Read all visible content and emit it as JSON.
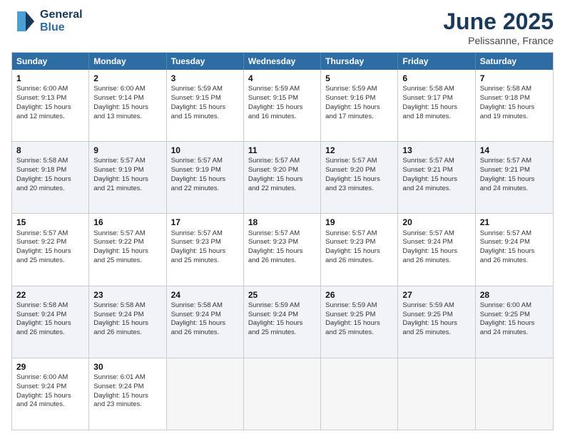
{
  "logo": {
    "line1": "General",
    "line2": "Blue"
  },
  "title": "June 2025",
  "subtitle": "Pelissanne, France",
  "header_days": [
    "Sunday",
    "Monday",
    "Tuesday",
    "Wednesday",
    "Thursday",
    "Friday",
    "Saturday"
  ],
  "rows": [
    [
      {
        "day": "1",
        "lines": [
          "Sunrise: 6:00 AM",
          "Sunset: 9:13 PM",
          "Daylight: 15 hours",
          "and 12 minutes."
        ]
      },
      {
        "day": "2",
        "lines": [
          "Sunrise: 6:00 AM",
          "Sunset: 9:14 PM",
          "Daylight: 15 hours",
          "and 13 minutes."
        ]
      },
      {
        "day": "3",
        "lines": [
          "Sunrise: 5:59 AM",
          "Sunset: 9:15 PM",
          "Daylight: 15 hours",
          "and 15 minutes."
        ]
      },
      {
        "day": "4",
        "lines": [
          "Sunrise: 5:59 AM",
          "Sunset: 9:15 PM",
          "Daylight: 15 hours",
          "and 16 minutes."
        ]
      },
      {
        "day": "5",
        "lines": [
          "Sunrise: 5:59 AM",
          "Sunset: 9:16 PM",
          "Daylight: 15 hours",
          "and 17 minutes."
        ]
      },
      {
        "day": "6",
        "lines": [
          "Sunrise: 5:58 AM",
          "Sunset: 9:17 PM",
          "Daylight: 15 hours",
          "and 18 minutes."
        ]
      },
      {
        "day": "7",
        "lines": [
          "Sunrise: 5:58 AM",
          "Sunset: 9:18 PM",
          "Daylight: 15 hours",
          "and 19 minutes."
        ]
      }
    ],
    [
      {
        "day": "8",
        "lines": [
          "Sunrise: 5:58 AM",
          "Sunset: 9:18 PM",
          "Daylight: 15 hours",
          "and 20 minutes."
        ]
      },
      {
        "day": "9",
        "lines": [
          "Sunrise: 5:57 AM",
          "Sunset: 9:19 PM",
          "Daylight: 15 hours",
          "and 21 minutes."
        ]
      },
      {
        "day": "10",
        "lines": [
          "Sunrise: 5:57 AM",
          "Sunset: 9:19 PM",
          "Daylight: 15 hours",
          "and 22 minutes."
        ]
      },
      {
        "day": "11",
        "lines": [
          "Sunrise: 5:57 AM",
          "Sunset: 9:20 PM",
          "Daylight: 15 hours",
          "and 22 minutes."
        ]
      },
      {
        "day": "12",
        "lines": [
          "Sunrise: 5:57 AM",
          "Sunset: 9:20 PM",
          "Daylight: 15 hours",
          "and 23 minutes."
        ]
      },
      {
        "day": "13",
        "lines": [
          "Sunrise: 5:57 AM",
          "Sunset: 9:21 PM",
          "Daylight: 15 hours",
          "and 24 minutes."
        ]
      },
      {
        "day": "14",
        "lines": [
          "Sunrise: 5:57 AM",
          "Sunset: 9:21 PM",
          "Daylight: 15 hours",
          "and 24 minutes."
        ]
      }
    ],
    [
      {
        "day": "15",
        "lines": [
          "Sunrise: 5:57 AM",
          "Sunset: 9:22 PM",
          "Daylight: 15 hours",
          "and 25 minutes."
        ]
      },
      {
        "day": "16",
        "lines": [
          "Sunrise: 5:57 AM",
          "Sunset: 9:22 PM",
          "Daylight: 15 hours",
          "and 25 minutes."
        ]
      },
      {
        "day": "17",
        "lines": [
          "Sunrise: 5:57 AM",
          "Sunset: 9:23 PM",
          "Daylight: 15 hours",
          "and 25 minutes."
        ]
      },
      {
        "day": "18",
        "lines": [
          "Sunrise: 5:57 AM",
          "Sunset: 9:23 PM",
          "Daylight: 15 hours",
          "and 26 minutes."
        ]
      },
      {
        "day": "19",
        "lines": [
          "Sunrise: 5:57 AM",
          "Sunset: 9:23 PM",
          "Daylight: 15 hours",
          "and 26 minutes."
        ]
      },
      {
        "day": "20",
        "lines": [
          "Sunrise: 5:57 AM",
          "Sunset: 9:24 PM",
          "Daylight: 15 hours",
          "and 26 minutes."
        ]
      },
      {
        "day": "21",
        "lines": [
          "Sunrise: 5:57 AM",
          "Sunset: 9:24 PM",
          "Daylight: 15 hours",
          "and 26 minutes."
        ]
      }
    ],
    [
      {
        "day": "22",
        "lines": [
          "Sunrise: 5:58 AM",
          "Sunset: 9:24 PM",
          "Daylight: 15 hours",
          "and 26 minutes."
        ]
      },
      {
        "day": "23",
        "lines": [
          "Sunrise: 5:58 AM",
          "Sunset: 9:24 PM",
          "Daylight: 15 hours",
          "and 26 minutes."
        ]
      },
      {
        "day": "24",
        "lines": [
          "Sunrise: 5:58 AM",
          "Sunset: 9:24 PM",
          "Daylight: 15 hours",
          "and 26 minutes."
        ]
      },
      {
        "day": "25",
        "lines": [
          "Sunrise: 5:59 AM",
          "Sunset: 9:24 PM",
          "Daylight: 15 hours",
          "and 25 minutes."
        ]
      },
      {
        "day": "26",
        "lines": [
          "Sunrise: 5:59 AM",
          "Sunset: 9:25 PM",
          "Daylight: 15 hours",
          "and 25 minutes."
        ]
      },
      {
        "day": "27",
        "lines": [
          "Sunrise: 5:59 AM",
          "Sunset: 9:25 PM",
          "Daylight: 15 hours",
          "and 25 minutes."
        ]
      },
      {
        "day": "28",
        "lines": [
          "Sunrise: 6:00 AM",
          "Sunset: 9:25 PM",
          "Daylight: 15 hours",
          "and 24 minutes."
        ]
      }
    ],
    [
      {
        "day": "29",
        "lines": [
          "Sunrise: 6:00 AM",
          "Sunset: 9:24 PM",
          "Daylight: 15 hours",
          "and 24 minutes."
        ]
      },
      {
        "day": "30",
        "lines": [
          "Sunrise: 6:01 AM",
          "Sunset: 9:24 PM",
          "Daylight: 15 hours",
          "and 23 minutes."
        ]
      },
      {
        "day": "",
        "lines": []
      },
      {
        "day": "",
        "lines": []
      },
      {
        "day": "",
        "lines": []
      },
      {
        "day": "",
        "lines": []
      },
      {
        "day": "",
        "lines": []
      }
    ]
  ]
}
